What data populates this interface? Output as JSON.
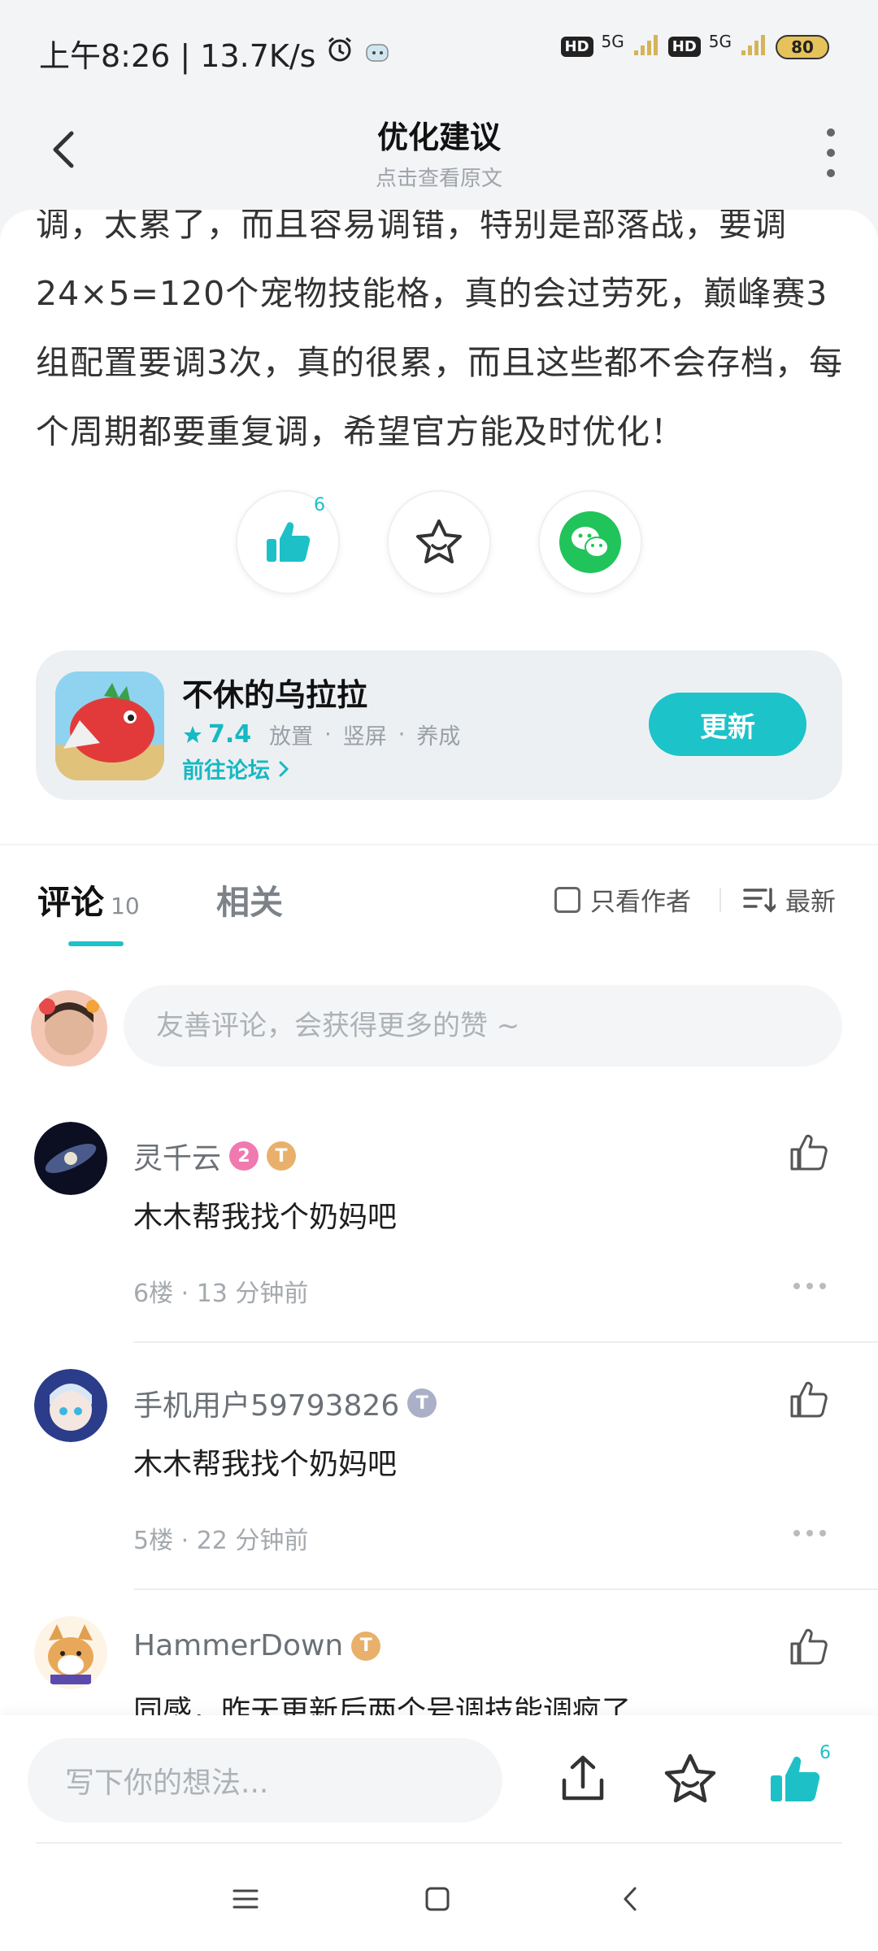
{
  "status_bar": {
    "time_speed": "上午8:26 | 13.7K/s",
    "hd1": "HD",
    "sig1": "5G",
    "hd2": "HD",
    "sig2": "5G",
    "battery": "80"
  },
  "header": {
    "title": "优化建议",
    "subtitle": "点击查看原文"
  },
  "article": {
    "partial_line": "调，太累了，而且容易调错，特别是部落战，要调",
    "text": "24×5=120个宠物技能格，真的会过劳死，巅峰赛3组配置要调3次，真的很累，而且这些都不会存档，每个周期都要重复调，希望官方能及时优化！",
    "like_count": "6"
  },
  "game": {
    "name": "不休的乌拉拉",
    "rating": "7.4",
    "tags": [
      "放置",
      "竖屏",
      "养成"
    ],
    "forum_link": "前往论坛",
    "update_button": "更新"
  },
  "comments": {
    "tab_label": "评论",
    "tab_count": "10",
    "related_tab": "相关",
    "author_only": "只看作者",
    "sort": "最新",
    "input_placeholder": "友善评论，会获得更多的赞 ~",
    "items": [
      {
        "user": "灵千云",
        "text": "木木帮我找个奶妈吧",
        "meta": "6楼 · 13 分钟前",
        "badges": [
          "2",
          "T"
        ]
      },
      {
        "user": "手机用户59793826",
        "text": "木木帮我找个奶妈吧",
        "meta": "5楼 · 22 分钟前",
        "badges": [
          "T"
        ]
      },
      {
        "user": "HammerDown",
        "text": "同感，昨天更新后两个号调技能调疯了",
        "meta": "",
        "badges": [
          "T"
        ]
      }
    ]
  },
  "bottom_bar": {
    "input_placeholder": "写下你的想法...",
    "like_count": "6"
  },
  "colors": {
    "accent": "#1cc3c9",
    "wechat_green": "#21c45a",
    "background": "#f2f4f6"
  }
}
